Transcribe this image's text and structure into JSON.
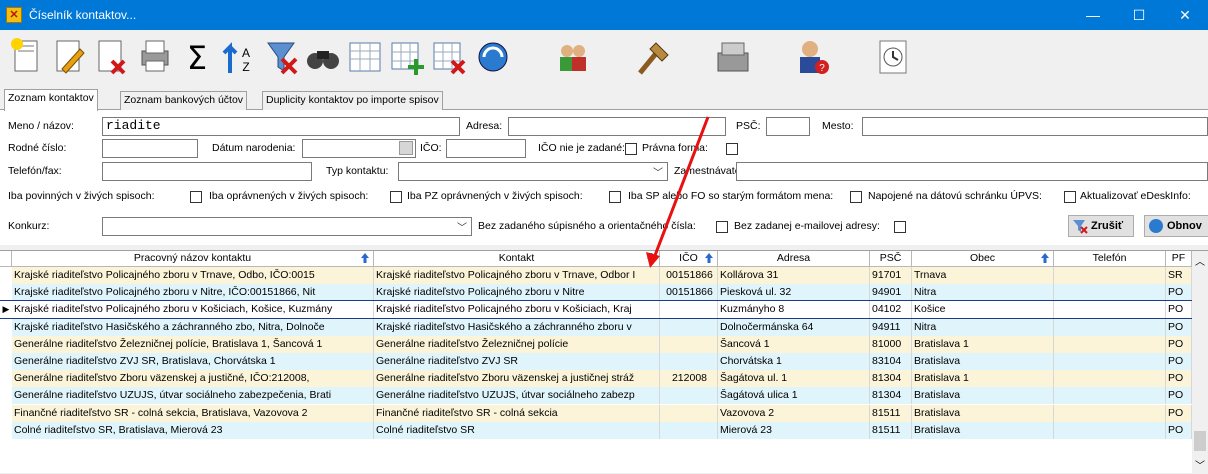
{
  "window": {
    "title": "Číselník kontaktov...",
    "minimize": "—",
    "maximize": "☐",
    "close": "✕"
  },
  "toolbar": {
    "buttons": [
      "new-contact",
      "edit-contact",
      "delete-contact",
      "print",
      "sum",
      "sort",
      "filter-clear",
      "find",
      "grid-view",
      "add-row",
      "delete-row",
      "refresh",
      "users",
      "tools",
      "export",
      "help-user",
      "history"
    ]
  },
  "tabs": [
    "Zoznam kontaktov",
    "Zoznam bankových účtov",
    "Duplicity kontaktov po importe spisov"
  ],
  "filters": {
    "meno_label": "Meno / názov:",
    "meno_value": "riadite",
    "adresa_label": "Adresa:",
    "psc_label": "PSČ:",
    "mesto_label": "Mesto:",
    "rodne_label": "Rodné číslo:",
    "datum_label": "Dátum narodenia:",
    "ico_label": "IČO:",
    "ico_nezadane_label": "IČO nie je zadané:",
    "pravna_forma_label": "Právna forma:",
    "telefon_label": "Telefón/fax:",
    "typ_label": "Typ kontaktu:",
    "zamestnavatel_label": "Zamestnávateľ:",
    "iba_povinnych_label": "Iba povinných v živých spisoch:",
    "iba_opravnenych_label": "Iba oprávnených v živých spisoch:",
    "iba_pz_label": "Iba PZ oprávnených v živých spisoch:",
    "iba_sp_label": "Iba SP alebo FO so starým formátom mena:",
    "napojene_label": "Napojené na dátovú schránku ÚPVS:",
    "aktualizovat_label": "Aktualizovať eDeskInfo:",
    "konkurz_label": "Konkurz:",
    "bez_supisneho_label": "Bez zadaného súpisného a orientačného čísla:",
    "bez_email_label": "Bez zadanej e-mailovej adresy:",
    "zrusit_label": "Zrušiť",
    "obnovit_label": "Obnov"
  },
  "grid": {
    "columns": [
      "Pracovný názov kontaktu",
      "Kontakt",
      "IČO",
      "Adresa",
      "PSČ",
      "Obec",
      "Telefón",
      "PF"
    ],
    "rows": [
      [
        "Krajské riaditeľstvo Policajného zboru v Trnave, Odbo, IČO:0015",
        "Krajské riaditeľstvo Policajného zboru v Trnave, Odbor I",
        "00151866",
        "Kollárova 31",
        "91701",
        "Trnava",
        "",
        "SR"
      ],
      [
        "Krajské riaditeľstvo Policajného zboru v Nitre, IČO:00151866, Nit",
        "Krajské riaditeľstvo Policajného zboru v Nitre",
        "00151866",
        "Piesková ul. 32",
        "94901",
        "Nitra",
        "",
        "PO"
      ],
      [
        "Krajské riaditeľstvo Policajného zboru v Košiciach, Košice, Kuzmány",
        "Krajské riaditeľstvo Policajného zboru v Košiciach, Kraj",
        "",
        "Kuzmányho 8",
        "04102",
        "Košice",
        "",
        "PO"
      ],
      [
        "Krajské riaditeľstvo Hasičského a záchranného zbo, Nitra, Dolnoče",
        "Krajské riaditeľstvo  Hasičského a záchranného zboru v",
        "",
        "Dolnočermánska 64",
        "94911",
        "Nitra",
        "",
        "PO"
      ],
      [
        "Generálne riaditeľstvo Železničnej polície, Bratislava 1, Šancová 1",
        "Generálne riaditeľstvo Železničnej polície",
        "",
        "Šancová 1",
        "81000",
        "Bratislava 1",
        "",
        "PO"
      ],
      [
        "Generálne riaditeľstvo ZVJ SR, Bratislava, Chorvátska 1",
        "Generálne riaditeľstvo ZVJ SR",
        "",
        "Chorvátska 1",
        "83104",
        "Bratislava",
        "",
        "PO"
      ],
      [
        "Generálne riaditeľstvo Zboru väzenskej a justičné, IČO:212008,",
        "Generálne riaditeľstvo Zboru väzenskej a justičnej stráž",
        "212008",
        "Šagátova ul. 1",
        "81304",
        "Bratislava 1",
        "",
        "PO"
      ],
      [
        "Generálne riaditeľstvo UZUJS, útvar sociálneho zabezpečenia, Brati",
        "Generálne riaditeľstvo UZUJS, útvar sociálneho zabezp",
        "",
        "Šagátová ulica 1",
        "81304",
        "Bratislava",
        "",
        "PO"
      ],
      [
        "Finančné riaditeľstvo SR - colná sekcia, Bratislava, Vazovova 2",
        "Finančné riaditeľstvo SR - colná sekcia",
        "",
        "Vazovova 2",
        "81511",
        "Bratislava",
        "",
        "PO"
      ],
      [
        "Colné riaditeľstvo SR, Bratislava, Mierová 23",
        "Colné riaditeľstvo SR",
        "",
        "Mierová 23",
        "81511",
        "Bratislava",
        "",
        "PO"
      ]
    ],
    "selected_row": 2,
    "row_colors": [
      "#fbf4d8",
      "#dff4fb"
    ]
  }
}
